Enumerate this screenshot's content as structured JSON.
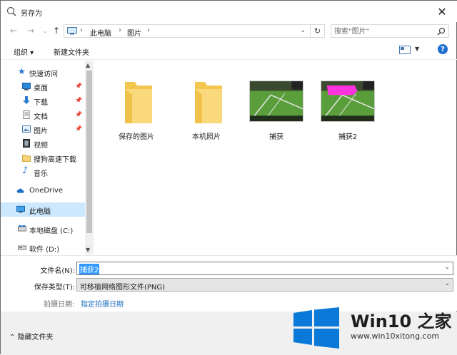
{
  "window": {
    "title": "另存为",
    "close_glyph": "✕"
  },
  "address": {
    "crumbs": [
      "此电脑",
      "图片"
    ],
    "search_placeholder": "搜索\"图片\""
  },
  "toolbar": {
    "organize": "组织 ▾",
    "new_folder": "新建文件夹",
    "help": "?"
  },
  "nav": {
    "items": [
      {
        "label": "快速访问",
        "icon": "star-icon",
        "pinned": false
      },
      {
        "label": "桌面",
        "icon": "desktop-icon",
        "pinned": true
      },
      {
        "label": "下载",
        "icon": "download-icon",
        "pinned": true
      },
      {
        "label": "文档",
        "icon": "document-icon",
        "pinned": true
      },
      {
        "label": "图片",
        "icon": "picture-icon",
        "pinned": true
      },
      {
        "label": "视频",
        "icon": "video-icon",
        "pinned": false
      },
      {
        "label": "搜狗高速下载",
        "icon": "folder-icon",
        "pinned": false
      },
      {
        "label": "音乐",
        "icon": "music-icon",
        "pinned": false
      },
      {
        "label": "OneDrive",
        "icon": "cloud-icon",
        "pinned": false
      },
      {
        "label": "此电脑",
        "icon": "computer-icon",
        "pinned": false
      },
      {
        "label": "本地磁盘 (C:)",
        "icon": "drive-icon",
        "pinned": false
      },
      {
        "label": "软件 (D:)",
        "icon": "drive-icon",
        "pinned": false
      }
    ]
  },
  "files": [
    {
      "name": "保存的图片",
      "kind": "folder"
    },
    {
      "name": "本机照片",
      "kind": "folder"
    },
    {
      "name": "捕获",
      "kind": "image"
    },
    {
      "name": "捕获2",
      "kind": "image"
    }
  ],
  "form": {
    "filename_label": "文件名(N):",
    "filename_value": "捕获2",
    "filetype_label": "保存类型(T):",
    "filetype_value": "可移植网络图形文件(PNG)",
    "date_label": "拍摄日期:",
    "date_link": "指定拍摄日期"
  },
  "bottom": {
    "hide_folders": "隐藏文件夹"
  },
  "watermark": {
    "title": "Win10 之家",
    "url": "www.win10xitong.com"
  },
  "colors": {
    "accent": "#1d6fd0",
    "selection": "#cce8ff",
    "link": "#1a6fbf",
    "win_blue": "#0a79d8"
  }
}
